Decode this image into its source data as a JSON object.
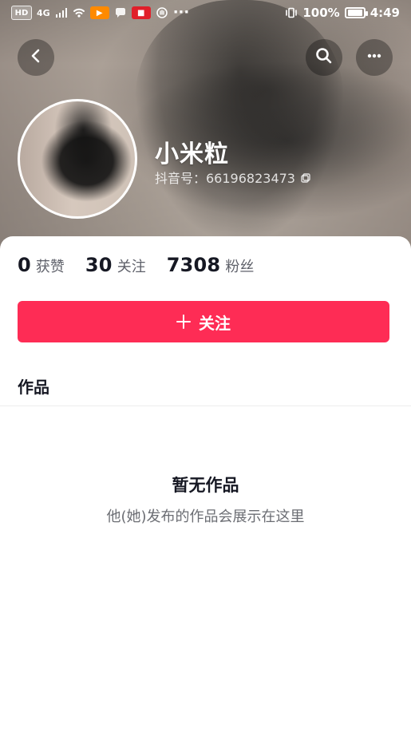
{
  "status_bar": {
    "left_badge_hd": "HD",
    "left_badge_4g": "4G",
    "battery_percent": "100%",
    "time": "4:49"
  },
  "profile": {
    "name": "小米粒",
    "douyin_id": "抖音号：66196823473"
  },
  "stats": [
    {
      "value": "0",
      "label": "获赞"
    },
    {
      "value": "30",
      "label": "关注"
    },
    {
      "value": "7308",
      "label": "粉丝"
    }
  ],
  "actions": {
    "follow_label": "关注"
  },
  "tabs": {
    "works_label": "作品"
  },
  "empty_state": {
    "title": "暂无作品",
    "subtitle": "他(她)发布的作品会展示在这里"
  },
  "colors": {
    "accent": "#fe2c55",
    "text_primary": "#161823",
    "text_secondary": "#6b6d73"
  },
  "icons": {
    "back": "chevron-left-icon",
    "search": "search-icon",
    "more": "more-dots-icon",
    "copy": "copy-icon",
    "plus": "plus-icon"
  }
}
